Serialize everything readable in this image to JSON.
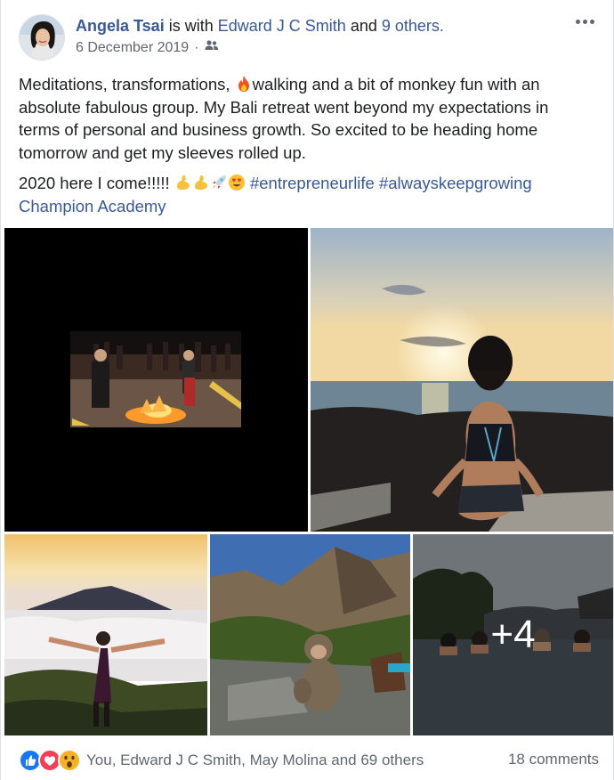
{
  "post": {
    "author": "Angela Tsai",
    "with_text": "is with",
    "tagged_person": "Edward J C Smith",
    "and_text": "and",
    "others_link": "9 others.",
    "date": "6 December 2019",
    "date_separator": "·",
    "audience_icon": "friends-icon",
    "paragraph1_a": "Meditations, transformations,",
    "paragraph1_b": "walking and a bit of monkey fun with an absolute fabulous group. My Bali retreat went beyond my expectations in terms of personal and business growth. So excited to be heading home tomorrow and get my sleeves rolled up.",
    "paragraph2_text": "2020 here I come!!!!!",
    "hashtag1": "#entrepreneurlife",
    "hashtag2": "#alwayskeepgrowing",
    "page_tag": "Champion Academy",
    "more_photos_count": "+4"
  },
  "footer": {
    "reaction_summary": "You, Edward J C Smith, May Molina and 69 others",
    "comments": "18 comments",
    "reaction_icons": [
      "like-icon",
      "love-icon",
      "wow-icon"
    ]
  },
  "colors": {
    "link": "#385898",
    "secondary_text": "#606770",
    "like_blue": "#1877f2",
    "love_red": "#f33e58",
    "wow_yellow": "#f7b125"
  }
}
